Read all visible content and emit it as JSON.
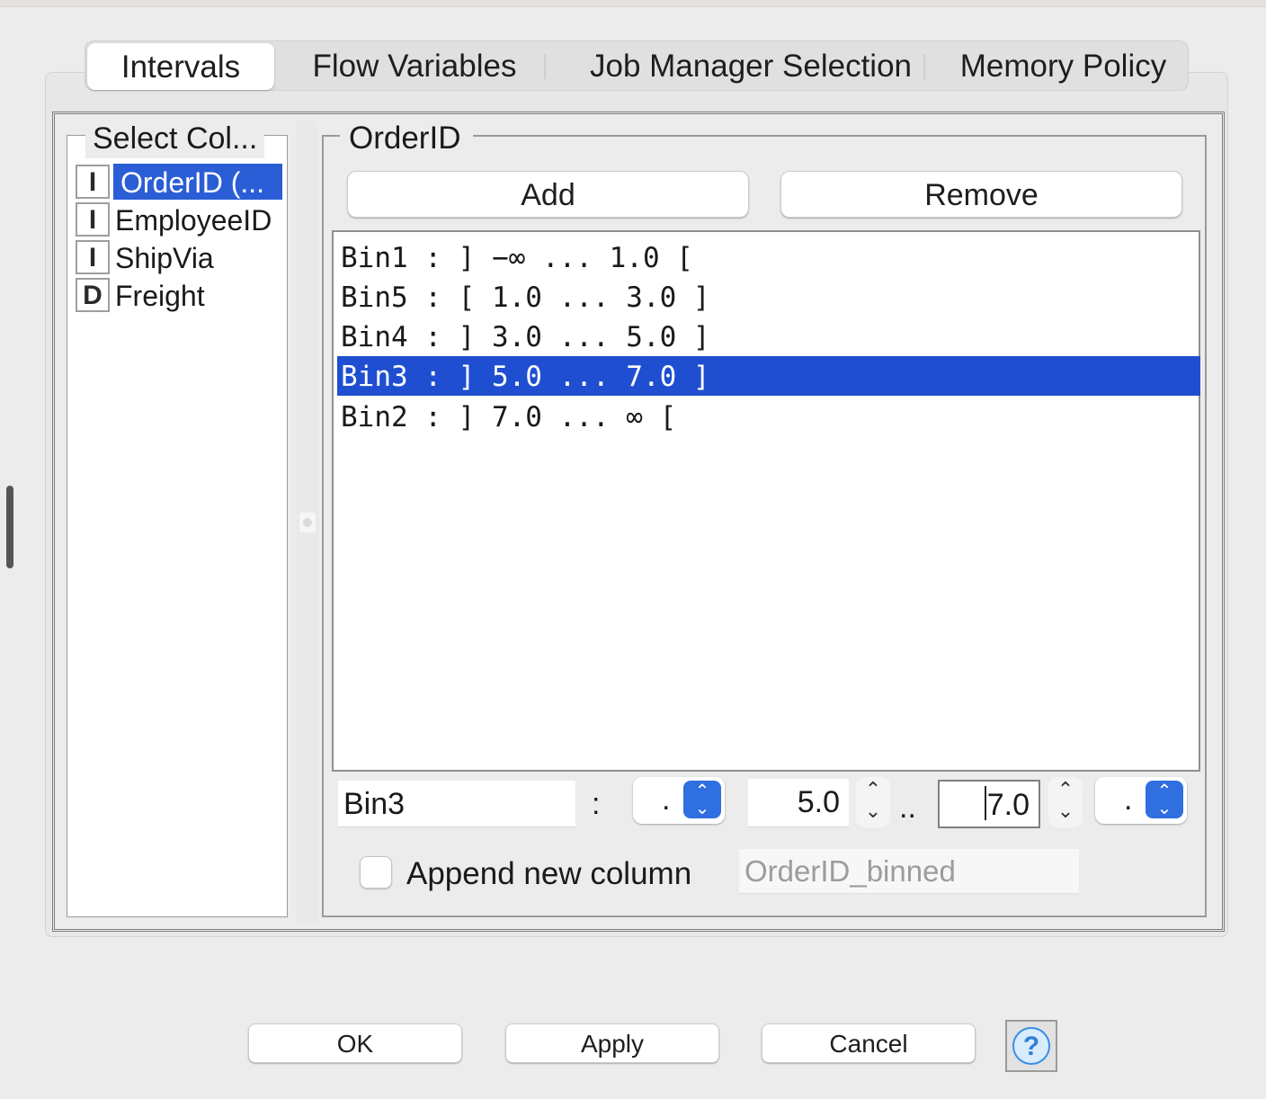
{
  "tabs": [
    "Intervals",
    "Flow Variables",
    "Job Manager Selection",
    "Memory Policy"
  ],
  "columns_group": {
    "title": "Select Col...",
    "items": [
      {
        "type": "I",
        "label": "OrderID (...",
        "selected": true
      },
      {
        "type": "I",
        "label": "EmployeeID",
        "selected": false
      },
      {
        "type": "I",
        "label": "ShipVia",
        "selected": false
      },
      {
        "type": "D",
        "label": "Freight",
        "selected": false
      }
    ]
  },
  "editor": {
    "title": "OrderID",
    "add_label": "Add",
    "remove_label": "Remove",
    "bins": [
      "Bin1 : ] −∞ ... 1.0 [",
      "Bin5 : [ 1.0 ... 3.0 ]",
      "Bin4 : ] 3.0 ... 5.0 ]",
      "Bin3 : ] 5.0 ... 7.0 ]",
      "Bin2 : ] 7.0 ... ∞ ["
    ],
    "selected_bin_index": 3,
    "bin_name": "Bin3",
    "colon": ":",
    "left_bracket": ".",
    "lower": "5.0",
    "range_sep": "..",
    "upper": "7.0",
    "right_bracket": ".",
    "append_label": "Append new column",
    "append_checked": false,
    "append_name": "OrderID_binned"
  },
  "footer": {
    "ok_label": "OK",
    "apply_label": "Apply",
    "cancel_label": "Cancel",
    "help_glyph": "?"
  },
  "colors": {
    "selection": "#1f4fd0",
    "combo_accent": "#2f6fe0"
  }
}
